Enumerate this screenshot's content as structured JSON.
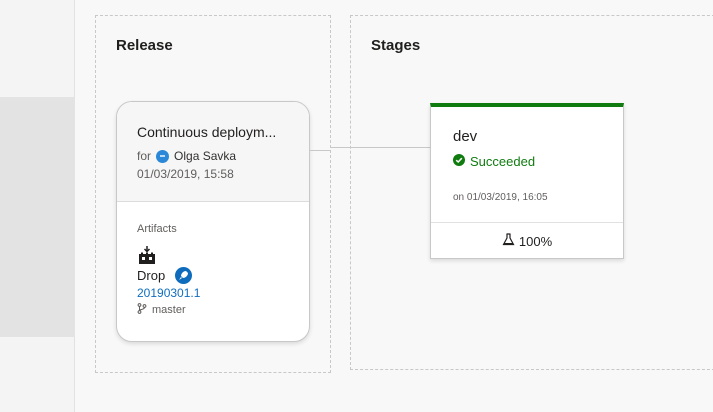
{
  "release_panel": {
    "title": "Release",
    "card": {
      "name": "Continuous deploym...",
      "for_label": "for",
      "user": "Olga Savka",
      "date": "01/03/2019, 15:58",
      "artifacts_label": "Artifacts",
      "artifact": {
        "name": "Drop",
        "build": "20190301.1",
        "branch": "master"
      }
    }
  },
  "stages_panel": {
    "title": "Stages",
    "stage": {
      "name": "dev",
      "status": "Succeeded",
      "date": "on 01/03/2019, 16:05",
      "test_pass_rate": "100%"
    }
  },
  "icons": {
    "avatar": "user-avatar-icon",
    "artifact": "build-artifact-icon",
    "build_badge": "rocket-badge-icon",
    "branch": "git-branch-icon",
    "status": "check-circle-icon",
    "tests": "flask-icon"
  },
  "colors": {
    "success": "#107c10",
    "link": "#106ebe",
    "badge": "#0f6cbd",
    "avatar": "#2b88d8"
  }
}
